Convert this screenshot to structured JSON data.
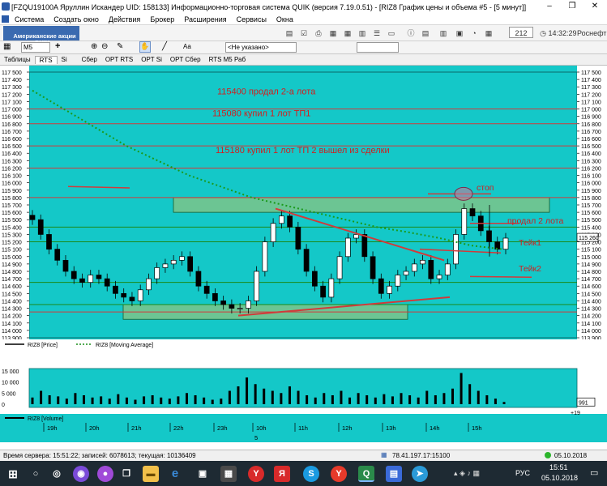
{
  "window": {
    "title": "[FZQU19100A Яруллин Искандер UID: 158133] Информационно-торговая система QUIK (версия 7.19.0.51) - [RIZ8 График цены и объема #5 - [5 минут]]",
    "minimize": "–",
    "restore": "❐",
    "close": "✕"
  },
  "menu": {
    "items": [
      "Система",
      "Создать окно",
      "Действия",
      "Брокер",
      "Расширения",
      "Сервисы",
      "Окна"
    ]
  },
  "toolbar": {
    "promo": "Американские акции\nтеперь в QUIK",
    "interval": "M5",
    "crosshair_label": "+",
    "font_label": "Aa",
    "account_select": "<Не указано>",
    "counter": "212",
    "clock": "14:32:29",
    "broker": "Роснефт"
  },
  "tabs": [
    "Таблицы",
    "RTS",
    "Si",
    "Сбер",
    "OPT RTS",
    "OPT Si",
    "OPT Сбер",
    "RTS M5 Раб"
  ],
  "chart_data": {
    "type": "candlestick",
    "instrument": "RIZ8",
    "timeframe": "5 минут",
    "ylim": [
      113900,
      117500
    ],
    "y_ticks": [
      117500,
      117400,
      117300,
      117200,
      117100,
      117000,
      116900,
      116800,
      116700,
      116600,
      116500,
      116400,
      116300,
      116200,
      116100,
      116000,
      115900,
      115800,
      115700,
      115600,
      115500,
      115400,
      115300,
      115200,
      115100,
      115000,
      114900,
      114800,
      114700,
      114600,
      114500,
      114400,
      114300,
      114200,
      114100,
      114000,
      113900
    ],
    "x_labels": [
      "19h",
      "20h",
      "21h",
      "22h",
      "23h",
      "10h",
      "11h",
      "12h",
      "13h",
      "14h",
      "15h"
    ],
    "x_sub_label": "5",
    "last_price_tag": "115 260",
    "legend": [
      {
        "name": "RIZ8 [Price]",
        "color": "#000000"
      },
      {
        "name": "RIZ8 [Moving Average]",
        "color": "#1a8f1a"
      }
    ],
    "volume_legend": "RIZ8 [Volume]",
    "volume_ticks": [
      "15 000",
      "10 000",
      "5 000",
      "0"
    ],
    "volume_last": "991",
    "scroll_marker": "+19",
    "close_path": [
      115500,
      115300,
      115100,
      114950,
      114800,
      114700,
      114650,
      114750,
      114700,
      114600,
      114500,
      114450,
      114400,
      114550,
      114700,
      114850,
      114900,
      114950,
      115000,
      114800,
      114600,
      114500,
      114400,
      114350,
      114300,
      114300,
      114400,
      114800,
      115200,
      115450,
      115550,
      115400,
      115100,
      114800,
      114600,
      114450,
      114700,
      115000,
      115250,
      115300,
      115000,
      114700,
      114500,
      114600,
      114750,
      114800,
      114900,
      114950,
      114700,
      114750,
      114900,
      115300,
      115650,
      115550,
      115350,
      115200,
      115100,
      115250
    ],
    "moving_average": [
      117250,
      117000,
      116750,
      116500,
      116300,
      116100,
      115950,
      115800,
      115700,
      115600,
      115500,
      115400,
      115330,
      115250,
      115150,
      115100
    ],
    "volume_values": [
      3000,
      6000,
      4000,
      3500,
      2500,
      5000,
      4000,
      3000,
      3500,
      2500,
      4500,
      3000,
      2000,
      3500,
      4000,
      3000,
      2500,
      3500,
      5000,
      4000,
      3000,
      2000,
      2500,
      6000,
      8000,
      12000,
      9000,
      7000,
      6000,
      5000,
      8000,
      6000,
      4000,
      3000,
      5000,
      4000,
      6000,
      3000,
      5000,
      4000,
      3000,
      4500,
      3500,
      5000,
      4000,
      3000,
      6000,
      4000,
      5000,
      7000,
      14000,
      9000,
      6000,
      4000,
      2500,
      1000
    ],
    "horizontal_levels": [
      117000,
      116800,
      116500,
      116200,
      115800,
      115400,
      115200,
      114650,
      114350,
      114250
    ],
    "zones": [
      {
        "from": 115600,
        "to": 115800,
        "label": ""
      },
      {
        "from": 114150,
        "to": 114350,
        "label": ""
      }
    ],
    "annotations": [
      {
        "text": "115400 продал 2-а лота",
        "price": 117200
      },
      {
        "text": "115080 купил 1 лот ТП1",
        "price": 116900
      },
      {
        "text": "115180 купил 1 лот ТП 2 вышел из сделки",
        "price": 116400
      },
      {
        "text": "стоп",
        "price": 115900
      },
      {
        "text": "продал 2 лота",
        "price": 115450
      },
      {
        "text": "Тейк1",
        "price": 115150
      },
      {
        "text": "Тейк2",
        "price": 114800
      }
    ]
  },
  "status": {
    "server_time": "Время сервера: 15:51:22; записей: 6078613; текущая: 10136409",
    "connection": "78.41.197.17:15100",
    "date": "05.10.2018"
  },
  "taskbar": {
    "lang": "РУС",
    "time": "15:51",
    "date": "05.10.2018"
  }
}
